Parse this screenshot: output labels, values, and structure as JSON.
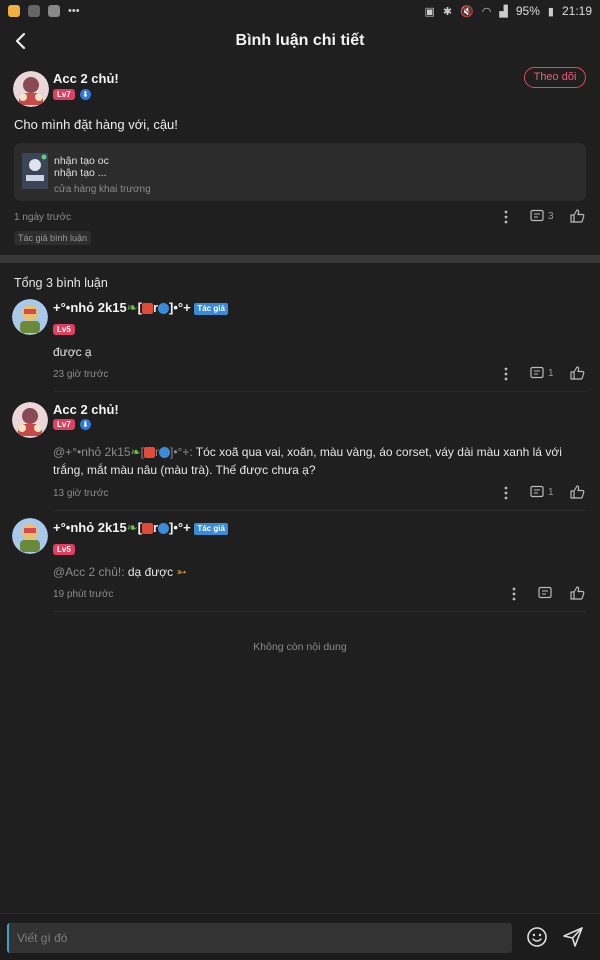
{
  "status_bar": {
    "battery": "95%",
    "time": "21:19"
  },
  "header": {
    "title": "Bình luận chi tiết"
  },
  "post": {
    "author": "Acc 2 chủ!",
    "level": "Lv7",
    "verified_mark": "⬇",
    "follow_label": "Theo dõi",
    "text": "Cho mình đặt hàng với, cậu!",
    "link_card": {
      "title_line1": "nhận tạo oc",
      "title_line2": "nhận tạo ...",
      "subtitle": "cửa hàng khai trương"
    },
    "time": "1 ngày trước",
    "reply_count": "3",
    "tag": "Tác giả bình luận"
  },
  "comments_header": "Tổng 3 bình luận",
  "comments": [
    {
      "author_prefix": "+°•nhỏ 2k15",
      "author_r": "r",
      "author_suffix": "•°+",
      "level": "Lv5",
      "author_badge": "Tác giả",
      "text": "được ạ",
      "time": "23 giờ trước",
      "reply_count": "1"
    },
    {
      "author": "Acc 2 chủ!",
      "level": "Lv7",
      "mention_prefix": "@+°•nhỏ 2k15",
      "mention_suffix": "•°+:",
      "text": " Tóc xoã qua vai, xoăn, màu vàng, áo corset, váy dài màu xanh lá với trắng, mắt màu nâu (màu trà). Thế được chưa ạ?",
      "time": "13 giờ trước",
      "reply_count": "1"
    },
    {
      "author_prefix": "+°•nhỏ 2k15",
      "author_r": "r",
      "author_suffix": "•°+",
      "level": "Lv5",
      "author_badge": "Tác giả",
      "mention": "@Acc 2 chủ!:",
      "text": " dạ được",
      "time": "19 phút trước"
    }
  ],
  "end_text": "Không còn nội dung",
  "input": {
    "placeholder": "Viết gì đó"
  },
  "icons": {
    "back": "back-arrow-icon",
    "more": "more-vertical-icon",
    "reply": "comment-icon",
    "like": "thumbs-up-icon",
    "emoji": "emoji-icon",
    "send": "send-icon"
  },
  "colors": {
    "accent": "#e8476a",
    "background": "#1f1f1f",
    "author_badge": "#3b8bd8"
  }
}
